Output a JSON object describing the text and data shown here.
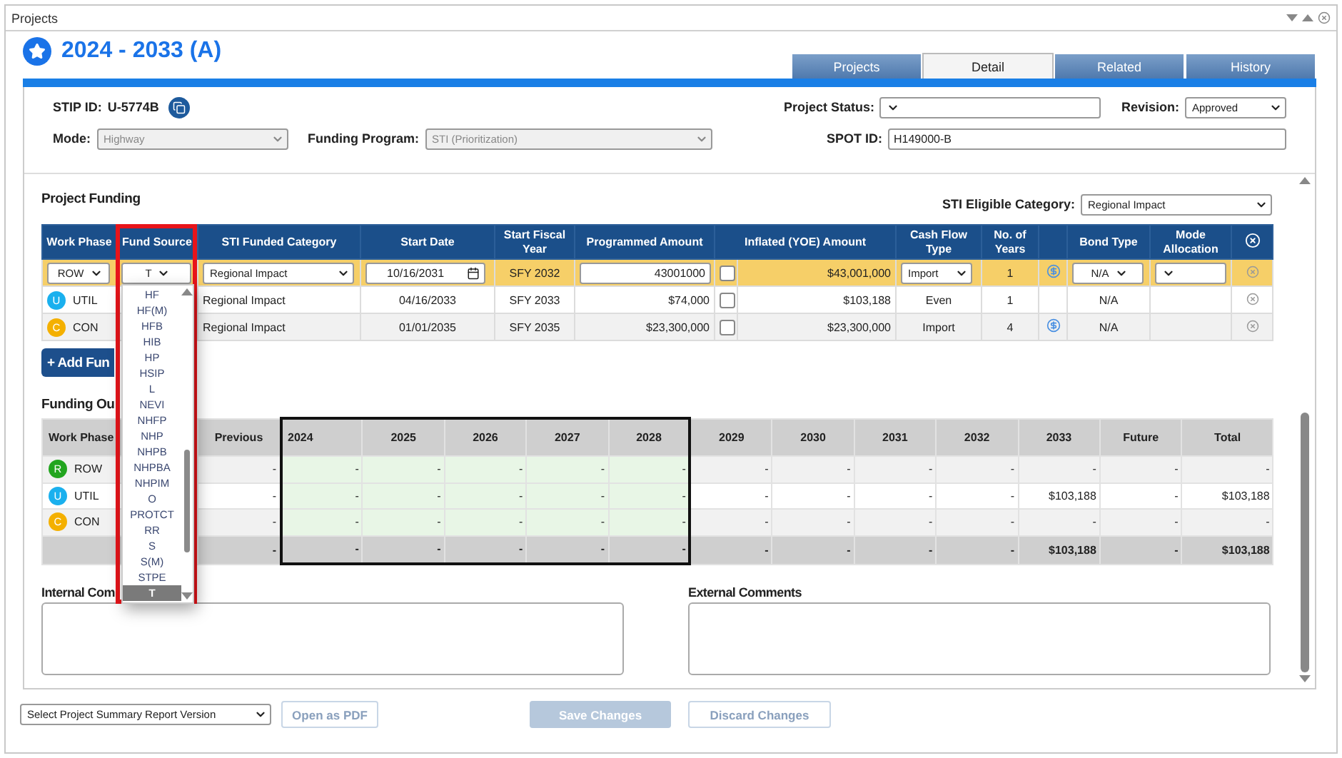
{
  "panel_title": "Projects",
  "title": "2024 - 2033 (A)",
  "tabs": [
    {
      "label": "Projects",
      "selected": false
    },
    {
      "label": "Detail",
      "selected": true
    },
    {
      "label": "Related",
      "selected": false
    },
    {
      "label": "History",
      "selected": false
    }
  ],
  "form": {
    "stip_label": "STIP ID:",
    "stip_id": "U-5774B",
    "mode_label": "Mode:",
    "mode": "Highway",
    "program_label": "Funding Program:",
    "program": "STI (Prioritization)",
    "status_label": "Project Status:",
    "revision_label": "Revision:",
    "revision": "Approved",
    "spot_label": "SPOT ID:",
    "spot_id": "H149000-B"
  },
  "project_funding": {
    "title": "Project Funding",
    "eligible_label": "STI Eligible Category:",
    "eligible": "Regional Impact",
    "columns": [
      "Work Phase",
      "Fund Source",
      "STI Funded Category",
      "Start Date",
      "Start Fiscal Year",
      "Programmed Amount",
      "Inflated (YOE) Amount",
      "Cash Flow Type",
      "No. of Years",
      "Bond Type",
      "Mode Allocation"
    ],
    "rows": [
      {
        "kind": "edit",
        "phase": "ROW",
        "fund": "T",
        "category": "Regional Impact",
        "start": "10/16/2031",
        "fiscal": "SFY 2032",
        "programmed": "43001000",
        "checked": false,
        "inflated": "$43,001,000",
        "cash": "Import",
        "years": "1",
        "dollar": true,
        "bond": "N/A"
      },
      {
        "kind": "view",
        "letter": "U",
        "color": "#1ab0ee",
        "phase": "UTIL",
        "category": "Regional Impact",
        "start": "04/16/2033",
        "fiscal": "SFY 2033",
        "programmed": "$74,000",
        "checked": false,
        "inflated": "$103,188",
        "cash": "Even",
        "years": "1",
        "dollar": false,
        "bond": "N/A"
      },
      {
        "kind": "view",
        "letter": "C",
        "color": "#f4b000",
        "phase": "CON",
        "category": "Regional Impact",
        "start": "01/01/2035",
        "fiscal": "SFY 2035",
        "programmed": "$23,300,000",
        "checked": false,
        "inflated": "$23,300,000",
        "cash": "Import",
        "years": "4",
        "dollar": true,
        "bond": "N/A"
      }
    ]
  },
  "add_button": "+ Add Fun",
  "outlay": {
    "title": "Funding Ou",
    "phase_header": "Work Phase",
    "columns": [
      {
        "label": "Previous",
        "highlighted": false
      },
      {
        "label": "2024",
        "highlighted": true
      },
      {
        "label": "2025",
        "highlighted": true
      },
      {
        "label": "2026",
        "highlighted": true
      },
      {
        "label": "2027",
        "highlighted": true
      },
      {
        "label": "2028",
        "highlighted": true
      },
      {
        "label": "2029",
        "highlighted": false
      },
      {
        "label": "2030",
        "highlighted": false
      },
      {
        "label": "2031",
        "highlighted": false
      },
      {
        "label": "2032",
        "highlighted": false
      },
      {
        "label": "2033",
        "highlighted": false
      },
      {
        "label": "Future",
        "highlighted": false
      },
      {
        "label": "Total",
        "highlighted": false
      }
    ],
    "rows": [
      {
        "letter": "R",
        "color": "#22a51f",
        "phase": "ROW",
        "cells": [
          "-",
          "-",
          "-",
          "-",
          "-",
          "-",
          "-",
          "-",
          "-",
          "-",
          "-",
          "-",
          "-"
        ]
      },
      {
        "letter": "U",
        "color": "#1ab0ee",
        "phase": "UTIL",
        "cells": [
          "-",
          "-",
          "-",
          "-",
          "-",
          "-",
          "-",
          "-",
          "-",
          "-",
          "$103,188",
          "-",
          "$103,188"
        ]
      },
      {
        "letter": "C",
        "color": "#f4b000",
        "phase": "CON",
        "cells": [
          "-",
          "-",
          "-",
          "-",
          "-",
          "-",
          "-",
          "-",
          "-",
          "-",
          "-",
          "-",
          "-"
        ]
      }
    ],
    "total_cells": [
      "-",
      "-",
      "-",
      "-",
      "-",
      "-",
      "-",
      "-",
      "-",
      "-",
      "$103,188",
      "-",
      "$103,188"
    ]
  },
  "fund_source_dropdown": [
    {
      "label": "HF",
      "selected": false
    },
    {
      "label": "HF(M)",
      "selected": false
    },
    {
      "label": "HFB",
      "selected": false
    },
    {
      "label": "HIB",
      "selected": false
    },
    {
      "label": "HP",
      "selected": false
    },
    {
      "label": "HSIP",
      "selected": false
    },
    {
      "label": "L",
      "selected": false
    },
    {
      "label": "NEVI",
      "selected": false
    },
    {
      "label": "NHFP",
      "selected": false
    },
    {
      "label": "NHP",
      "selected": false
    },
    {
      "label": "NHPB",
      "selected": false
    },
    {
      "label": "NHPBA",
      "selected": false
    },
    {
      "label": "NHPIM",
      "selected": false
    },
    {
      "label": "O",
      "selected": false
    },
    {
      "label": "PROTCT",
      "selected": false
    },
    {
      "label": "RR",
      "selected": false
    },
    {
      "label": "S",
      "selected": false
    },
    {
      "label": "S(M)",
      "selected": false
    },
    {
      "label": "STPE",
      "selected": false
    },
    {
      "label": "T",
      "selected": true
    }
  ],
  "comments": [
    {
      "label": "Internal Com"
    },
    {
      "label": "External Comments"
    }
  ],
  "footer": {
    "report_select": "Select Project Summary Report Version",
    "open_pdf": "Open as PDF",
    "save": "Save Changes",
    "discard": "Discard Changes"
  }
}
